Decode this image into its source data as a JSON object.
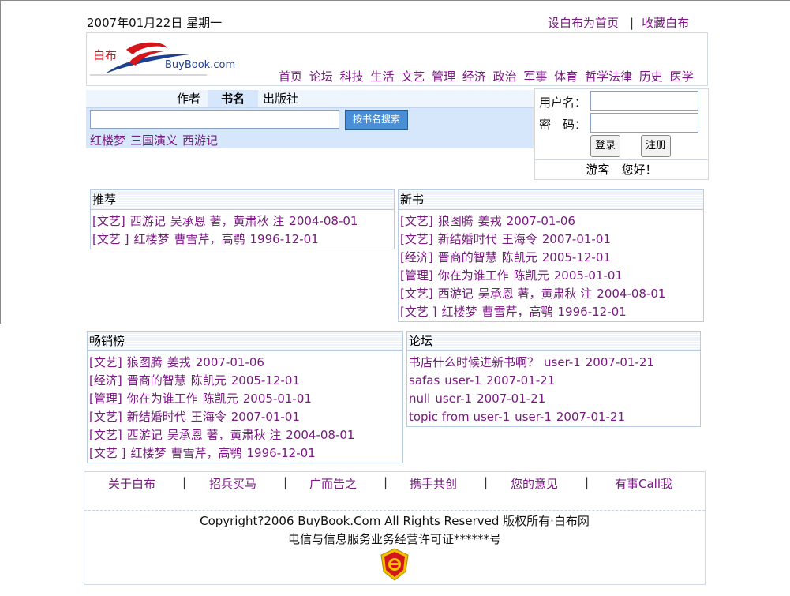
{
  "header": {
    "date": "2007年01月22日 星期一",
    "set_home": "设白布为首页",
    "separator": "|",
    "bookmark": "收藏白布"
  },
  "logo": {
    "cn_text": "白布",
    "en_text": "BuyBook.com"
  },
  "nav": [
    "首页",
    "论坛",
    "科技",
    "生活",
    "文艺",
    "管理",
    "经济",
    "政治",
    "军事",
    "体育",
    "哲学法律",
    "历史",
    "医学"
  ],
  "search": {
    "tabs": [
      "作者",
      "书名",
      "出版社"
    ],
    "active_tab": "书名",
    "input_value": "",
    "button_label": "按书名搜索",
    "hot_books": [
      "红楼梦",
      "三国演义",
      "西游记"
    ]
  },
  "login": {
    "username_label": "用户名：",
    "password_label": "密　码：",
    "login_button": "登录",
    "register_button": "注册",
    "guest": "游客",
    "hello": "您好！"
  },
  "recommend": {
    "title": "推荐",
    "items": [
      [
        "[文艺]",
        "西游记",
        "吴承恩 著，黄肃秋 注",
        "2004-08-01"
      ],
      [
        "[文艺 ]",
        "红楼梦",
        "曹雪芹，高鹗",
        "1996-12-01"
      ]
    ]
  },
  "new_books": {
    "title": "新书",
    "items": [
      [
        "[文艺]",
        "狼图腾",
        "姜戎",
        "2007-01-06"
      ],
      [
        "[文艺]",
        "新结婚时代",
        "王海令",
        "2007-01-01"
      ],
      [
        "[经济]",
        "晋商的智慧",
        "陈凯元",
        "2005-12-01"
      ],
      [
        "[管理]",
        "你在为谁工作",
        "陈凯元",
        "2005-01-01"
      ],
      [
        "[文艺]",
        "西游记",
        "吴承恩 著，黄肃秋 注",
        "2004-08-01"
      ],
      [
        "[文艺 ]",
        "红楼梦",
        "曹雪芹，高鹗",
        "1996-12-01"
      ]
    ]
  },
  "bestsellers": {
    "title": "畅销榜",
    "items": [
      [
        "[文艺]",
        "狼图腾",
        "姜戎",
        "2007-01-06"
      ],
      [
        "[经济]",
        "晋商的智慧",
        "陈凯元",
        "2005-12-01"
      ],
      [
        "[管理]",
        "你在为谁工作",
        "陈凯元",
        "2005-01-01"
      ],
      [
        "[文艺]",
        "新结婚时代",
        "王海令",
        "2007-01-01"
      ],
      [
        "[文艺]",
        "西游记",
        "吴承恩 著，黄肃秋 注",
        "2004-08-01"
      ],
      [
        "[文艺 ]",
        "红楼梦",
        "曹雪芹，高鹗",
        "1996-12-01"
      ]
    ]
  },
  "forum": {
    "title": "论坛",
    "items": [
      [
        "书店什么时候进新书啊？",
        "user-1",
        "2007-01-21"
      ],
      [
        "safas",
        "user-1",
        "2007-01-21"
      ],
      [
        "null",
        "user-1",
        "2007-01-21"
      ],
      [
        "topic from user-1",
        "user-1",
        "2007-01-21"
      ]
    ]
  },
  "footer": {
    "links": [
      "关于白布",
      "招兵买马",
      "广而告之",
      "携手共创",
      "您的意见",
      "有事Call我"
    ],
    "separator": "|",
    "copyright": "Copyright?2006 BuyBook.Com All Rights Reserved 版权所有·白布网",
    "license": "电信与信息服务业务经营许可证******号"
  },
  "colors": {
    "link": "#7a1a82",
    "search_bg": "#d6e6fb",
    "panel_border": "#b9cce3",
    "badge_red": "#d4161c",
    "badge_gold": "#f2c200"
  }
}
